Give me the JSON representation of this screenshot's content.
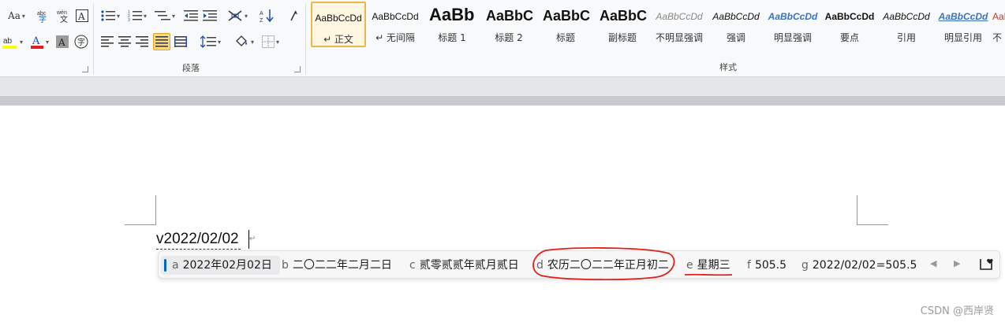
{
  "ribbon": {
    "font_group": {
      "change_case": "Aa",
      "highlight_color": "#ffff00",
      "font_color": "#e02020"
    },
    "paragraph_group": {
      "label": "段落"
    },
    "styles_group": {
      "label": "样式",
      "items": [
        {
          "sample": "AaBbCcDd",
          "name": "↵ 正文",
          "selected": true
        },
        {
          "sample": "AaBbCcDd",
          "name": "↵ 无间隔",
          "selected": false
        },
        {
          "sample": "AaBb",
          "name": "标题 1",
          "selected": false
        },
        {
          "sample": "AaBbC",
          "name": "标题 2",
          "selected": false
        },
        {
          "sample": "AaBbC",
          "name": "标题",
          "selected": false
        },
        {
          "sample": "AaBbC",
          "name": "副标题",
          "selected": false
        },
        {
          "sample": "AaBbCcDd",
          "name": "不明显强调",
          "selected": false
        },
        {
          "sample": "AaBbCcDd",
          "name": "强调",
          "selected": false
        },
        {
          "sample": "AaBbCcDd",
          "name": "明显强调",
          "selected": false
        },
        {
          "sample": "AaBbCcDd",
          "name": "要点",
          "selected": false
        },
        {
          "sample": "AaBbCcDd",
          "name": "引用",
          "selected": false
        },
        {
          "sample": "AaBbCcDd",
          "name": "明显引用",
          "selected": false
        },
        {
          "sample": "AaBbCcDd",
          "name": "不",
          "selected": false
        }
      ]
    }
  },
  "document": {
    "typed_text": "v2022/02/02",
    "paragraph_mark": "↵"
  },
  "ime": {
    "candidates": [
      {
        "key": "a",
        "text": "2022年02月02日"
      },
      {
        "key": "b",
        "text": "二〇二二年二月二日"
      },
      {
        "key": "c",
        "text": "贰零贰贰年贰月贰日"
      },
      {
        "key": "d",
        "text": "农历二〇二二年正月初二"
      },
      {
        "key": "e",
        "text": "星期三"
      },
      {
        "key": "f",
        "text": "505.5"
      },
      {
        "key": "g",
        "text": "2022/02/02=505.5"
      }
    ],
    "prev_arrow": "◀",
    "next_arrow": "▶",
    "accent_color": "#0067c0"
  },
  "annotation_color": "#e0201a",
  "watermark": "CSDN @西岸贤"
}
